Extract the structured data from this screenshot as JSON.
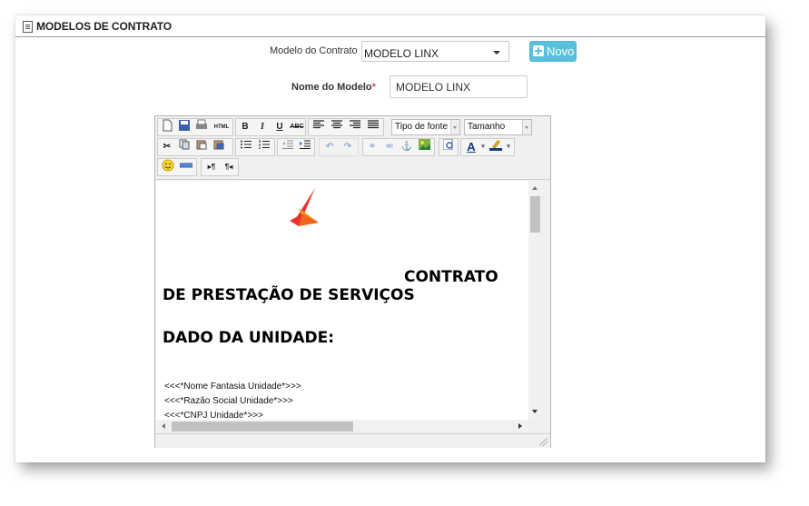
{
  "header": {
    "title": "MODELOS DE CONTRATO",
    "icon": "document-icon"
  },
  "form": {
    "modelo_label": "Modelo do Contrato",
    "modelo_value": "MODELO LINX",
    "novo_label": "Novo",
    "nome_label": "Nome do Modelo",
    "required_mark": "*",
    "nome_value": "MODELO LINX"
  },
  "toolbar": {
    "font_select": "Tipo de fonte",
    "size_select": "Tamanho"
  },
  "document": {
    "heading_contrato": "CONTRATO",
    "heading_prestacao": "DE PRESTAÇÃO DE SERVIÇOS",
    "heading_dado": "DADO DA UNIDADE:",
    "fields": [
      "<<<*Nome Fantasia Unidade*>>>",
      "<<<*Razão Social Unidade*>>>",
      "<<<*CNPJ Unidade*>>>"
    ]
  },
  "colors": {
    "accent": "#5bc0de",
    "required": "#d9534f",
    "logo_red": "#e8322a",
    "logo_orange": "#f39a1e"
  }
}
